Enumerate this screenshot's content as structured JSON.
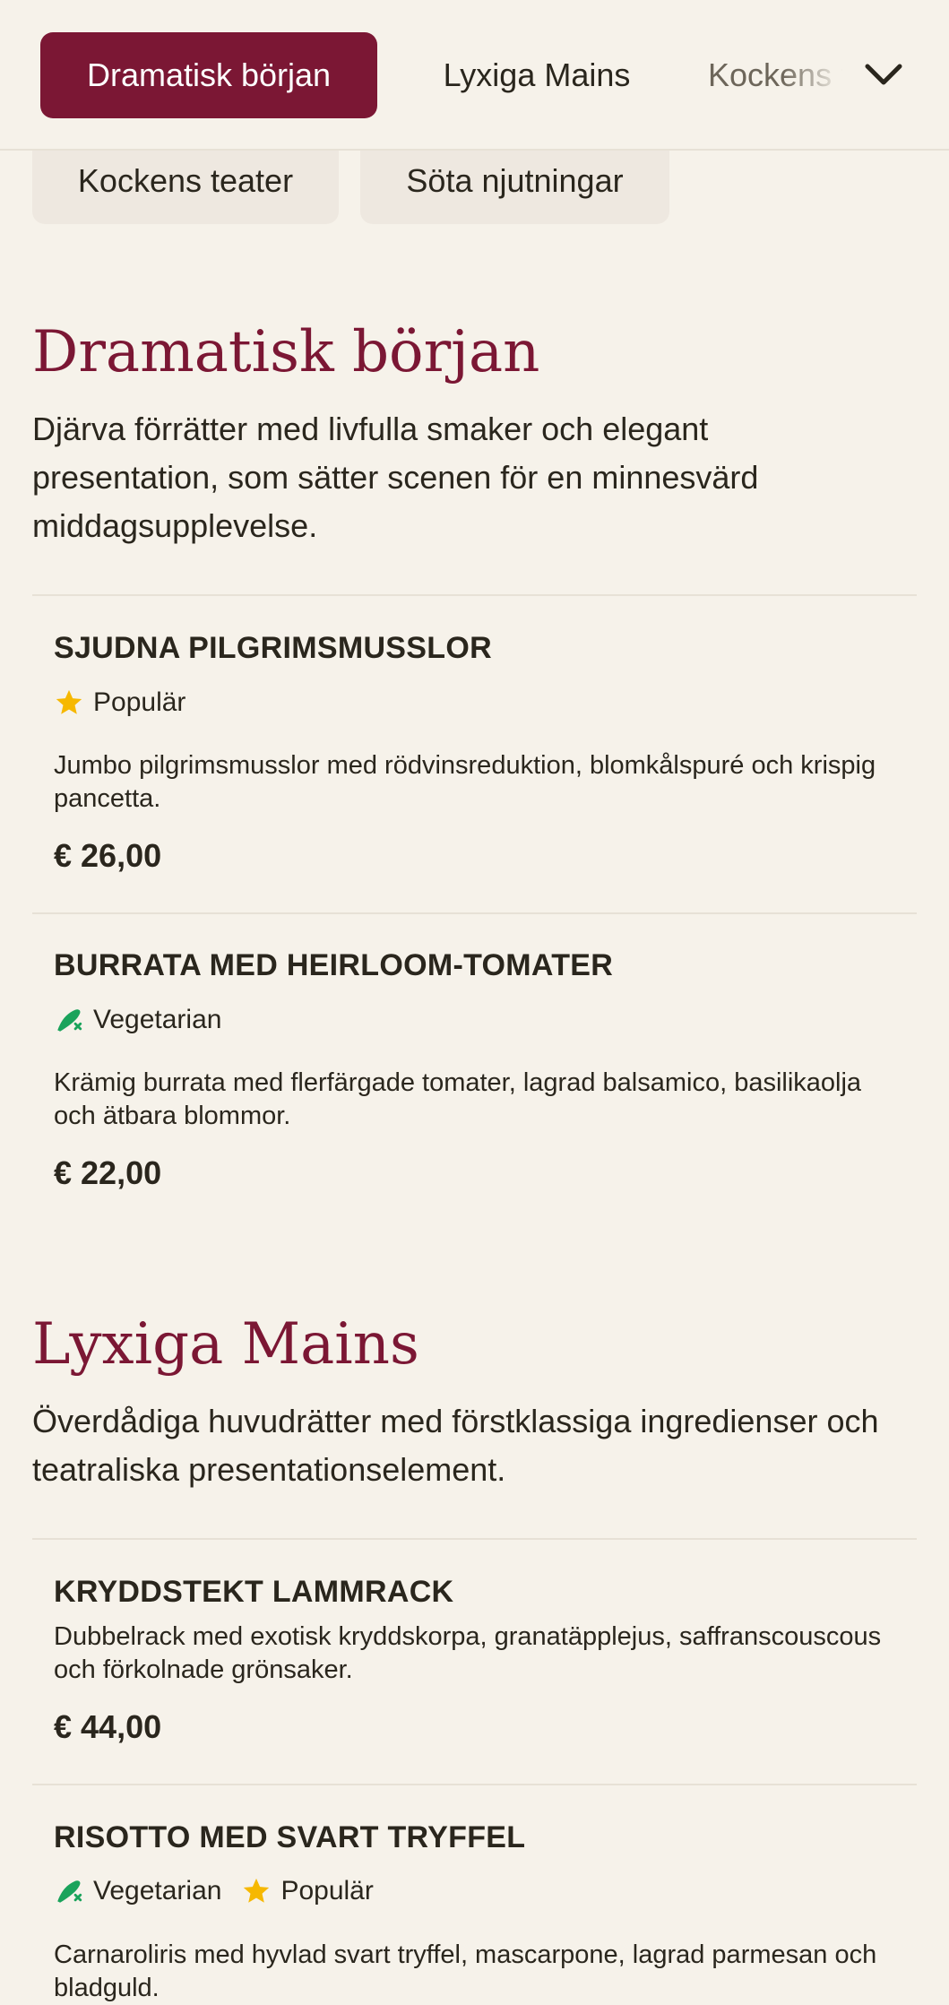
{
  "nav": {
    "tabs": [
      {
        "label": "Dramatisk början",
        "active": true
      },
      {
        "label": "Lyxiga Mains",
        "active": false
      },
      {
        "label": "Kockens teater",
        "active": false
      }
    ],
    "overflow_icon": "chevron-down-icon",
    "chips": [
      {
        "label": "Kockens teater"
      },
      {
        "label": "Söta njutningar"
      }
    ]
  },
  "colors": {
    "accent": "#7b1734",
    "background": "#f6f2ea",
    "chip": "#eee8e0",
    "star": "#f6b800",
    "vegetarian": "#1aa35b"
  },
  "sections": [
    {
      "title": "Dramatisk början",
      "description": "Djärva förrätter med livfulla smaker och elegant presentation, som sätter scenen för en minnesvärd middagsupplevelse.",
      "items": [
        {
          "name": "SJUDNA PILGRIMSMUSSLOR",
          "badges": [
            {
              "icon": "star-icon",
              "label": "Populär"
            }
          ],
          "description": "Jumbo pilgrimsmusslor med rödvinsreduktion, blomkålspuré och krispig pancetta.",
          "price": "€ 26,00"
        },
        {
          "name": "BURRATA MED HEIRLOOM-TOMATER",
          "badges": [
            {
              "icon": "vegetarian-icon",
              "label": "Vegetarian"
            }
          ],
          "description": "Krämig burrata med flerfärgade tomater, lagrad balsamico, basilikaolja och ätbara blommor.",
          "price": "€ 22,00"
        }
      ]
    },
    {
      "title": "Lyxiga Mains",
      "description": "Överdådiga huvudrätter med förstklassiga ingredienser och teatraliska presentationselement.",
      "items": [
        {
          "name": "KRYDDSTEKT LAMMRACK",
          "badges": [],
          "description": "Dubbelrack med exotisk kryddskorpa, granatäpplejus, saffranscouscous och förkolnade grönsaker.",
          "price": "€ 44,00"
        },
        {
          "name": "RISOTTO MED SVART TRYFFEL",
          "badges": [
            {
              "icon": "vegetarian-icon",
              "label": "Vegetarian"
            },
            {
              "icon": "star-icon",
              "label": "Populär"
            }
          ],
          "description": "Carnaroliris med hyvlad svart tryffel, mascarpone, lagrad parmesan och bladguld.",
          "price": ""
        }
      ]
    }
  ]
}
